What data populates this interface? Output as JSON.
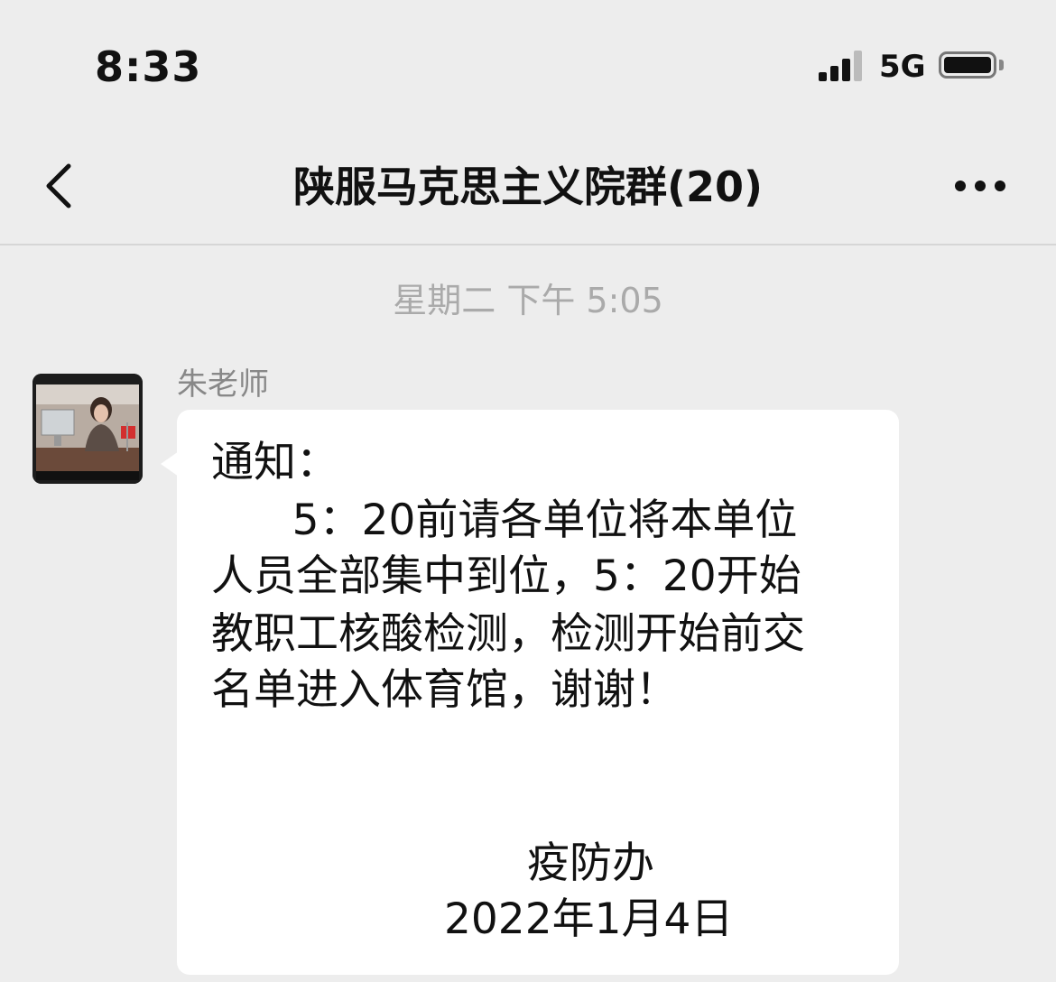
{
  "status_bar": {
    "time": "8:33",
    "network": "5G",
    "signal_icon": "cellular-signal-icon",
    "battery_icon": "battery-icon"
  },
  "nav": {
    "title": "陕服马克思主义院群(20)",
    "back_icon": "chevron-left-icon",
    "more_icon": "more-dots-icon"
  },
  "chat": {
    "timestamp": "星期二 下午 5:05",
    "messages": [
      {
        "sender": "朱老师",
        "avatar_icon": "avatar-photo",
        "lines": [
          "通知：",
          "      5：20前请各单位将本单位",
          "人员全部集中到位，5：20开始",
          "教职工核酸检测，检测开始前交",
          "名单进入体育馆，谢谢！"
        ],
        "signature": "疫防办",
        "date": "2022年1月4日"
      }
    ]
  },
  "colors": {
    "background": "#ededed",
    "bubble": "#ffffff",
    "text": "#111111",
    "muted": "#888888"
  }
}
